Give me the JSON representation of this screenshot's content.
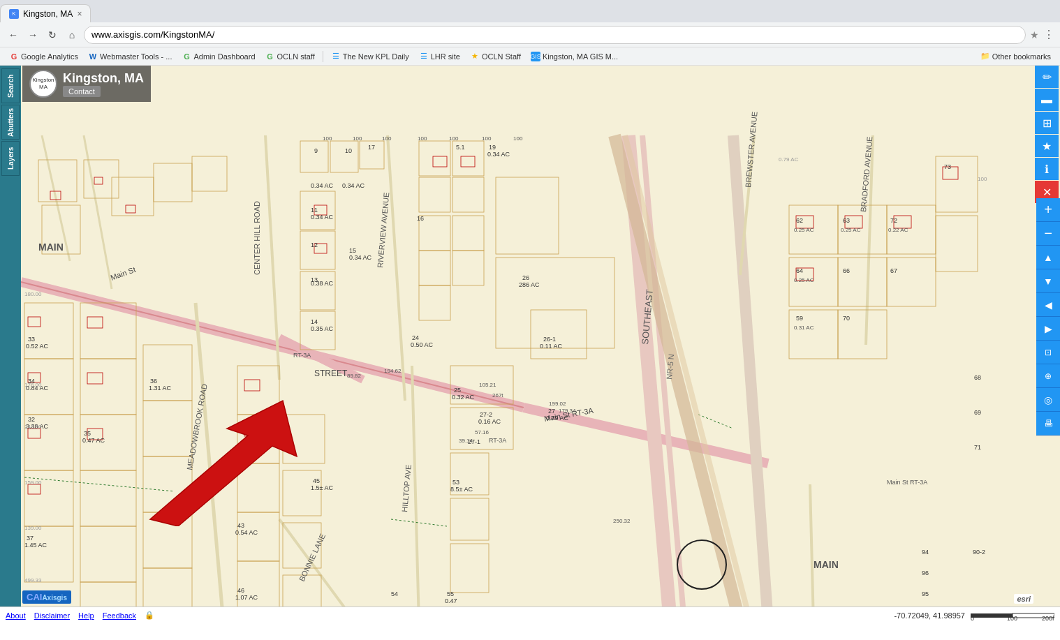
{
  "browser": {
    "tab": {
      "favicon": "K",
      "title": "Kingston, MA",
      "close": "×"
    },
    "address": "www.axisgis.com/KingstonMA/",
    "bookmarks": [
      {
        "id": "google-analytics",
        "icon": "G",
        "label": "Google Analytics",
        "color": "#e53935"
      },
      {
        "id": "webmaster-tools",
        "icon": "W",
        "label": "Webmaster Tools - ...",
        "color": "#1565c0"
      },
      {
        "id": "admin-dashboard",
        "icon": "G",
        "label": "Admin Dashboard",
        "color": "#4caf50"
      },
      {
        "id": "ocln-staff",
        "icon": "G",
        "label": "OCLN staff",
        "color": "#4caf50"
      },
      {
        "id": "new-kpl-daily",
        "icon": "☰",
        "label": "The New KPL Daily",
        "color": "#2196f3"
      },
      {
        "id": "lhr-site",
        "icon": "☰",
        "label": "LHR site",
        "color": "#2196f3"
      },
      {
        "id": "ocln-staff-2",
        "icon": "★",
        "label": "OCLN Staff",
        "color": "#f4b400"
      },
      {
        "id": "kingston-gis",
        "icon": "☰",
        "label": "Kingston, MA GIS M...",
        "color": "#2196f3"
      }
    ],
    "other_bookmarks": "Other bookmarks"
  },
  "map": {
    "title": "Kingston, MA",
    "contact_btn": "Contact",
    "url": "www.axisgis.com/KingstonMA/",
    "coordinates": "-70.72049, 41.98957",
    "left_panel": {
      "buttons": [
        "Search",
        "Abutters",
        "Layers"
      ]
    },
    "right_toolbar": {
      "buttons": [
        {
          "id": "pencil",
          "symbol": "✏",
          "color": "blue",
          "label": "edit-icon"
        },
        {
          "id": "rect",
          "symbol": "▬",
          "color": "blue",
          "label": "rectangle-icon"
        },
        {
          "id": "grid",
          "symbol": "⊞",
          "color": "blue",
          "label": "grid-icon"
        },
        {
          "id": "star",
          "symbol": "★",
          "color": "blue",
          "label": "star-icon"
        },
        {
          "id": "info",
          "symbol": "ℹ",
          "color": "blue",
          "label": "info-icon"
        },
        {
          "id": "delete",
          "symbol": "✕",
          "color": "red",
          "label": "delete-icon"
        }
      ],
      "zoom_buttons": [
        {
          "id": "zoom-plus",
          "symbol": "+",
          "label": "zoom-in-icon"
        },
        {
          "id": "zoom-minus",
          "symbol": "−",
          "label": "zoom-out-icon"
        },
        {
          "id": "pan-up",
          "symbol": "↑",
          "label": "pan-up-icon"
        },
        {
          "id": "pan-down",
          "symbol": "↓",
          "label": "pan-down-icon"
        },
        {
          "id": "pan-left",
          "symbol": "←",
          "label": "pan-left-icon"
        },
        {
          "id": "pan-right",
          "symbol": "→",
          "label": "pan-right-icon"
        },
        {
          "id": "zoom-fit",
          "symbol": "⊡",
          "label": "zoom-fit-icon"
        },
        {
          "id": "search-loc",
          "symbol": "⊕",
          "label": "search-location-icon"
        },
        {
          "id": "locate-me",
          "symbol": "◎",
          "label": "locate-me-icon"
        },
        {
          "id": "print",
          "symbol": "🖶",
          "label": "print-icon"
        }
      ]
    },
    "status_bar": {
      "about": "About",
      "disclaimer": "Disclaimer",
      "help": "Help",
      "feedback": "Feedback",
      "lock": "🔒",
      "coordinates": "-70.72049, 41.98957",
      "scale_label": "100",
      "scale_label2": "200ft"
    },
    "cai_logo": "CAI",
    "esri_logo": "esri"
  }
}
